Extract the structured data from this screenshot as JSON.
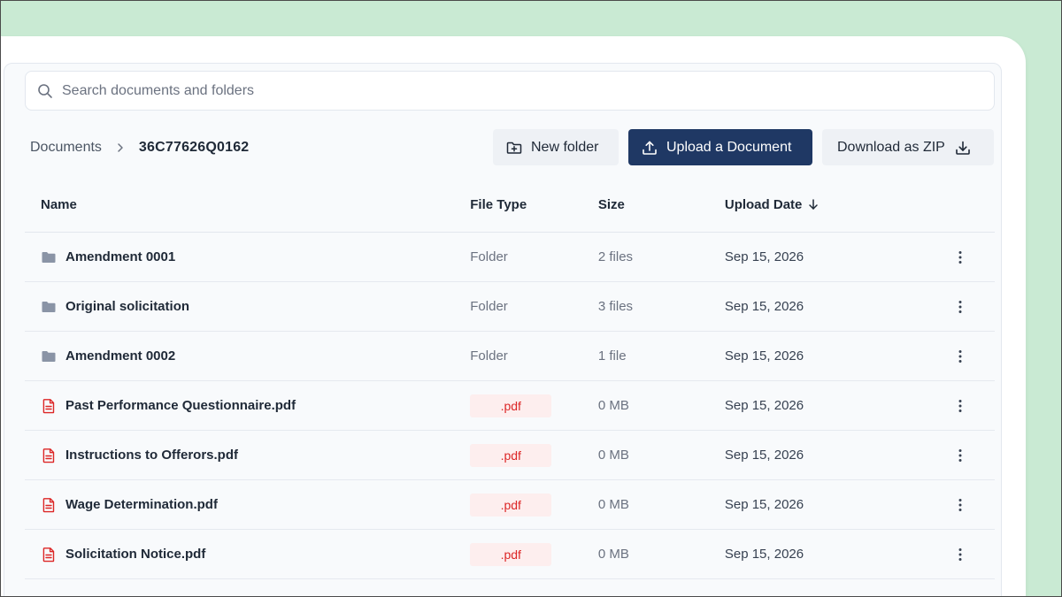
{
  "search": {
    "placeholder": "Search documents and folders",
    "value": ""
  },
  "breadcrumb": {
    "root": "Documents",
    "current": "36C77626Q0162"
  },
  "toolbar": {
    "new_folder": "New folder",
    "upload": "Upload a Document",
    "download_zip": "Download as ZIP"
  },
  "table": {
    "headers": {
      "name": "Name",
      "type": "File Type",
      "size": "Size",
      "date": "Upload Date"
    },
    "sort": {
      "column": "date",
      "direction": "descending"
    },
    "rows": [
      {
        "kind": "folder",
        "name": "Amendment 0001",
        "type": "Folder",
        "size": "2 files",
        "date": "Sep 15, 2026"
      },
      {
        "kind": "folder",
        "name": "Original solicitation",
        "type": "Folder",
        "size": "3 files",
        "date": "Sep 15, 2026"
      },
      {
        "kind": "folder",
        "name": "Amendment 0002",
        "type": "Folder",
        "size": "1 file",
        "date": "Sep 15, 2026"
      },
      {
        "kind": "pdf",
        "name": "Past Performance Questionnaire.pdf",
        "type": ".pdf",
        "size": "0 MB",
        "date": "Sep 15, 2026"
      },
      {
        "kind": "pdf",
        "name": "Instructions to Offerors.pdf",
        "type": ".pdf",
        "size": "0 MB",
        "date": "Sep 15, 2026"
      },
      {
        "kind": "pdf",
        "name": "Wage Determination.pdf",
        "type": ".pdf",
        "size": "0 MB",
        "date": "Sep 15, 2026"
      },
      {
        "kind": "pdf",
        "name": "Solicitation Notice.pdf",
        "type": ".pdf",
        "size": "0 MB",
        "date": "Sep 15, 2026"
      }
    ]
  },
  "colors": {
    "background": "#c9ead3",
    "primary_button": "#1f3864",
    "pdf_icon": "#dc2626",
    "pdf_badge_bg": "#fdeeee",
    "folder_icon": "#8a94a6"
  }
}
